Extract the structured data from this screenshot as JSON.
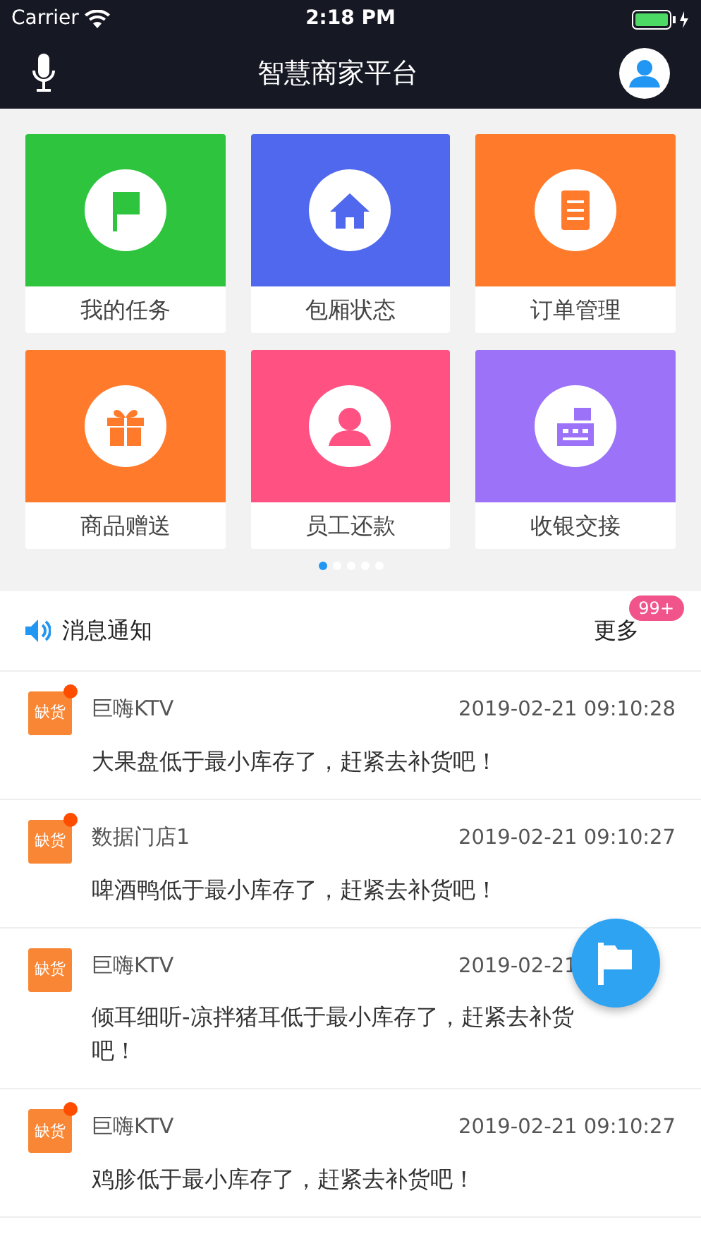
{
  "status_bar": {
    "carrier": "Carrier",
    "time": "2:18 PM"
  },
  "nav": {
    "title": "智慧商家平台"
  },
  "tiles": [
    {
      "label": "我的任务",
      "color": "#2ec43e",
      "kind": "flag"
    },
    {
      "label": "包厢状态",
      "color": "#5068ee",
      "kind": "home"
    },
    {
      "label": "订单管理",
      "color": "#ff7a2a",
      "kind": "doc"
    },
    {
      "label": "商品赠送",
      "color": "#ff7a2a",
      "kind": "gift"
    },
    {
      "label": "员工还款",
      "color": "#ff5283",
      "kind": "person"
    },
    {
      "label": "收银交接",
      "color": "#9b72f8",
      "kind": "register"
    }
  ],
  "pager": [
    {
      "selected": true
    },
    {
      "selected": false
    },
    {
      "selected": false
    },
    {
      "selected": false
    },
    {
      "selected": false
    }
  ],
  "notices_header": {
    "title": "消息通知",
    "more": "更多",
    "badge": "99+"
  },
  "notices": [
    {
      "tag": "缺货",
      "unread": true,
      "store": "巨嗨KTV",
      "time": "2019-02-21 09:10:28",
      "message": "大果盘低于最小库存了，赶紧去补货吧！"
    },
    {
      "tag": "缺货",
      "unread": true,
      "store": "数据门店1",
      "time": "2019-02-21 09:10:27",
      "message": "啤酒鸭低于最小库存了，赶紧去补货吧！"
    },
    {
      "tag": "缺货",
      "unread": false,
      "store": "巨嗨KTV",
      "time": "2019-02-21",
      "message": "倾耳细听-凉拌猪耳低于最小库存了，赶紧去补货吧！"
    },
    {
      "tag": "缺货",
      "unread": true,
      "store": "巨嗨KTV",
      "time": "2019-02-21 09:10:27",
      "message": "鸡胗低于最小库存了，赶紧去补货吧！"
    }
  ]
}
